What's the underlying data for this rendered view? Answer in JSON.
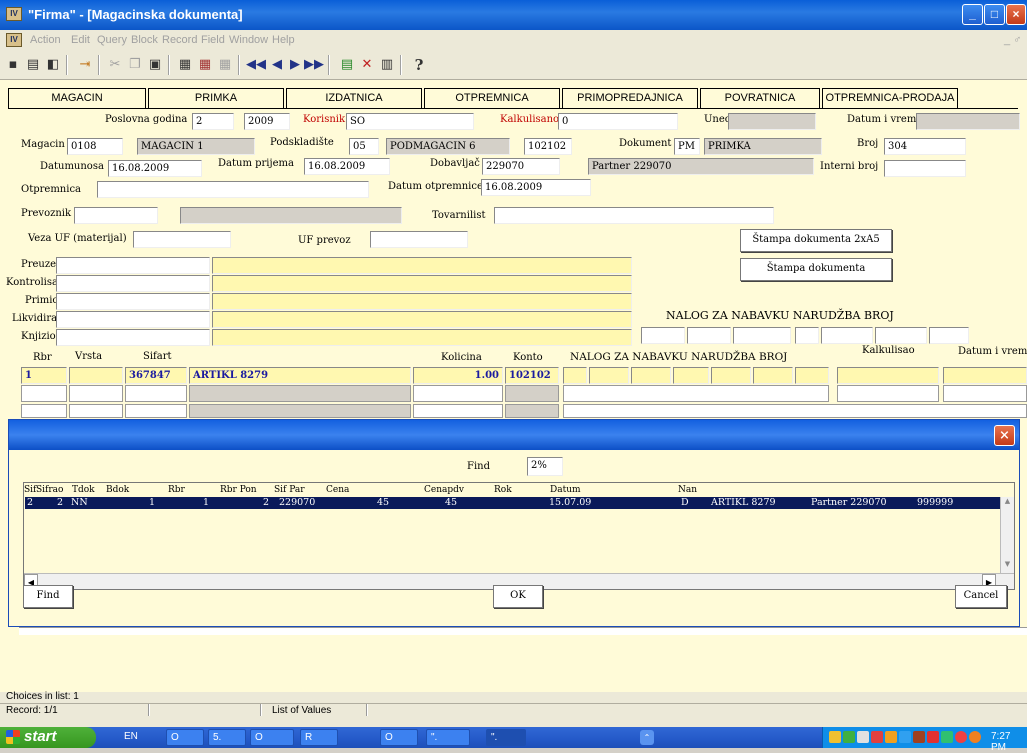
{
  "window": {
    "title": "\"Firma\" - [Magacinska dokumenta]",
    "app_icon": "app-icon",
    "minimize": "_",
    "maximize": "□",
    "close": "×"
  },
  "menu": {
    "items": [
      "Action",
      "Edit",
      "Query",
      "Block",
      "Record",
      "Field",
      "Window",
      "Help"
    ],
    "right": "_ ♂"
  },
  "toolbar": {
    "icons": [
      "save-icon",
      "print-icon",
      "print-preview-icon",
      "exit-icon",
      "cut-icon",
      "copy-icon",
      "paste-icon",
      "duplicate-icon",
      "insert-record-icon",
      "clear-icon",
      "first-record-icon",
      "previous-record-icon",
      "next-record-icon",
      "last-record-icon",
      "add-row-icon",
      "delete-row-icon",
      "lock-icon",
      "help-icon"
    ],
    "help": "?"
  },
  "tabs": [
    "MAGACIN",
    "PRIMKA",
    "IZDATNICA",
    "OTPREMNICA",
    "PRIMOPREDAJNICA",
    "POVRATNICA",
    "OTPREMNICA-PRODAJA"
  ],
  "form": {
    "poslovna_godina_label": "Poslovna godina",
    "poslovna_godina_val": "2",
    "godina": "2009",
    "korisnik_label": "Korisnik",
    "korisnik_val": "SO",
    "kalkulisano_label": "Kalkulisano",
    "kalkulisano_val": "0",
    "uneo_label": "Uneo",
    "uneo_val": "",
    "datum_vreme_label": "Datum i vreme",
    "datum_vreme_val": "",
    "magacin_label": "Magacin",
    "magacin_val": "0108",
    "magacin_name": "MAGACIN 1",
    "podskladiste_label": "Podskladište",
    "podskladiste_val": "05",
    "podskladiste_name": "PODMAGACIN 6",
    "podskladiste_konto": "102102",
    "dokument_label": "Dokument",
    "dokument_val": "PM",
    "dokument_name": "PRIMKA",
    "broj_label": "Broj",
    "broj_val": "304",
    "datumunosa_label": "Datumunosa",
    "datumunosa_val": "16.08.2009",
    "datum_prijema_label": "Datum prijema",
    "datum_prijema_val": "16.08.2009",
    "dobavljac_label": "Dobavljač",
    "dobavljac_val": "229070",
    "dobavljac_name": "Partner 229070",
    "interni_broj_label": "Interni broj",
    "interni_broj_val": "",
    "otpremnica_label": "Otpremnica",
    "otpremnica_val": "",
    "datum_otpremnice_label": "Datum otpremnice",
    "datum_otpremnice_val": "16.08.2009",
    "prevoznik_label": "Prevoznik",
    "prevoznik_val": "",
    "prevoznik_name": "",
    "tovarnilist_label": "Tovarnilist",
    "tovarnilist_val": "",
    "veza_uf_label": "Veza UF (materijal)",
    "veza_uf_val": "",
    "uf_prevoz_label": "UF prevoz",
    "uf_prevoz_val": "",
    "stampa_2xa5": "Štampa dokumenta  2xA5",
    "stampa": "Štampa dokumenta",
    "signatures": [
      "Preuzeo",
      "Kontrolisao",
      "Primio",
      "Likvidirao",
      "Knjizio"
    ],
    "nalog_label": "NALOG ZA NABAVKU NARUDŽBA BROJ"
  },
  "grid": {
    "headers": {
      "rbr": "Rbr",
      "vrsta": "Vrsta",
      "sifart": "Sifart",
      "kolicina": "Kolicina",
      "konto": "Konto",
      "nalog": "NALOG ZA NABAVKU NARUDŽBA BROJ",
      "kalkulisao": "Kalkulisao",
      "datum_vreme": "Datum i vreme"
    },
    "row1": {
      "rbr": "1",
      "vrsta": "",
      "sifart": "367847",
      "naziv": "ARTIKL 8279",
      "kolicina": "1.00",
      "konto": "102102"
    }
  },
  "dialog": {
    "close": "×",
    "find_label": "Find",
    "find_val": "2%",
    "columns": [
      "Sif",
      "Sifrao",
      "Tdok",
      "Bdok",
      "Rbr",
      "Rbr Pon",
      "Sif Par",
      "Cena",
      "Cenapdv",
      "Rok",
      "Datum",
      "Nan"
    ],
    "row": {
      "sif": "2",
      "sifrao": "2",
      "tdok": "NN",
      "bdok": "1",
      "rbr": "1",
      "rbr_pon": "2",
      "sif_par": "229070",
      "cena": "45",
      "cenapdv": "45",
      "datum": "15.07.09",
      "nan": "D",
      "artikl": "ARTIKL 8279",
      "partner": "Partner 229070",
      "extra": "999999"
    },
    "find_btn": "Find",
    "ok_btn": "OK",
    "cancel_btn": "Cancel"
  },
  "status": {
    "choices": "Choices in list: 1",
    "record": "Record: 1/1",
    "lov": "List of Values"
  },
  "taskbar": {
    "start": "start",
    "lang": "EN",
    "tasks": [
      "O",
      "5.",
      "O",
      "R",
      "O",
      "\".",
      "\"."
    ],
    "clock": "7:27 PM"
  }
}
